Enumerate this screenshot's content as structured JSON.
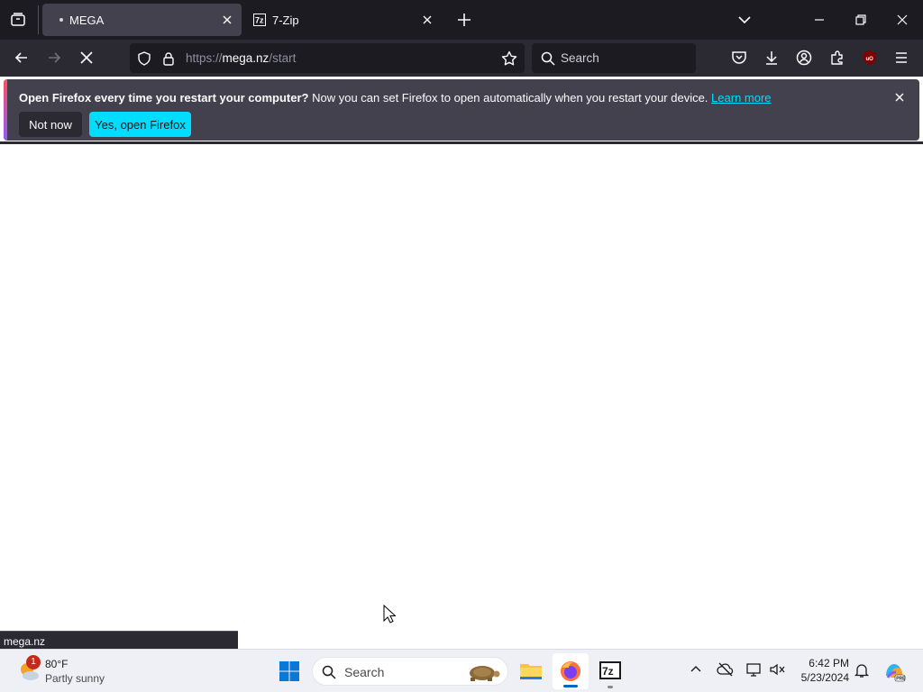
{
  "browser": {
    "tabs": [
      {
        "title": "MEGA",
        "active": true,
        "icon": "mega-loading-dot"
      },
      {
        "title": "7-Zip",
        "active": false,
        "icon": "7zip-favicon"
      }
    ],
    "address": {
      "prefix": "https://",
      "host": "mega.nz",
      "path": "/start"
    },
    "search_placeholder": "Search"
  },
  "notification": {
    "bold": "Open Firefox every time you restart your computer?",
    "message": " Now you can set Firefox to open automatically when you restart your device. ",
    "link": "Learn more",
    "buttons": {
      "not_now": "Not now",
      "yes": "Yes, open Firefox"
    }
  },
  "status_url": "mega.nz",
  "taskbar": {
    "weather": {
      "temp": "80°F",
      "desc": "Partly sunny",
      "badge": "1"
    },
    "search_placeholder": "Search",
    "clock": {
      "time": "6:42 PM",
      "date": "5/23/2024"
    }
  },
  "colors": {
    "accent": "#00ddff",
    "toolbar": "#2b2a33",
    "tabstrip": "#1c1b22"
  }
}
